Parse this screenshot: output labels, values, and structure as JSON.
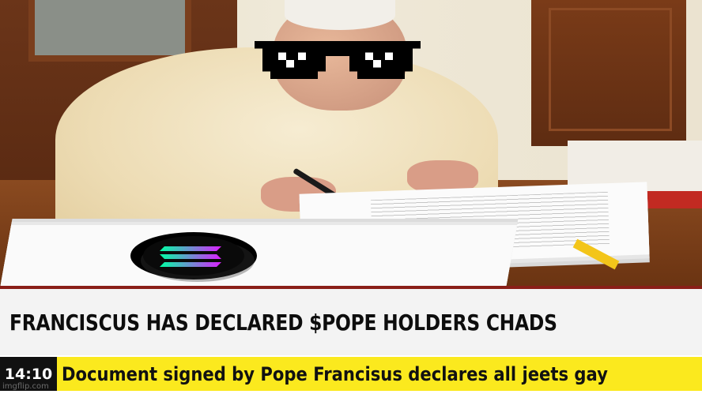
{
  "headline": "FRANCISCUS HAS DECLARED $POPE HOLDERS CHADS",
  "ticker": {
    "time": "14:10",
    "text": "Document signed by Pope Francisus declares all jeets gay"
  },
  "watermark": "imgflip.com",
  "colors": {
    "headline_bg": "#f3f3f3",
    "ticker_bg": "#fbe91e",
    "clock_bg": "#111111",
    "accent_bar": "#8a1f18"
  },
  "overlays": {
    "sunglasses": "pixel-sunglasses-icon",
    "token": "solana-logo-icon"
  }
}
